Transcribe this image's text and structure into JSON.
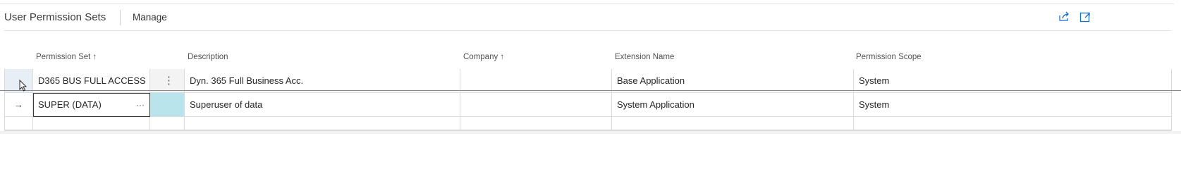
{
  "header": {
    "title": "User Permission Sets",
    "manage_label": "Manage",
    "icons": [
      "share-icon",
      "expand-icon"
    ]
  },
  "columns": {
    "permission_set": "Permission Set ↑",
    "description": "Description",
    "company": "Company ↑",
    "extension_name": "Extension Name",
    "permission_scope": "Permission Scope"
  },
  "rows": [
    {
      "permission_set": "D365 BUS FULL ACCESS",
      "description": "Dyn. 365 Full Business Acc.",
      "company": "",
      "extension_name": "Base Application",
      "permission_scope": "System"
    },
    {
      "indicator": "→",
      "permission_set": "SUPER (DATA)",
      "description": "Superuser of data",
      "company": "",
      "extension_name": "System Application",
      "permission_scope": "System"
    }
  ],
  "row_menu_glyph": "⋮",
  "lookup_glyph": "···"
}
